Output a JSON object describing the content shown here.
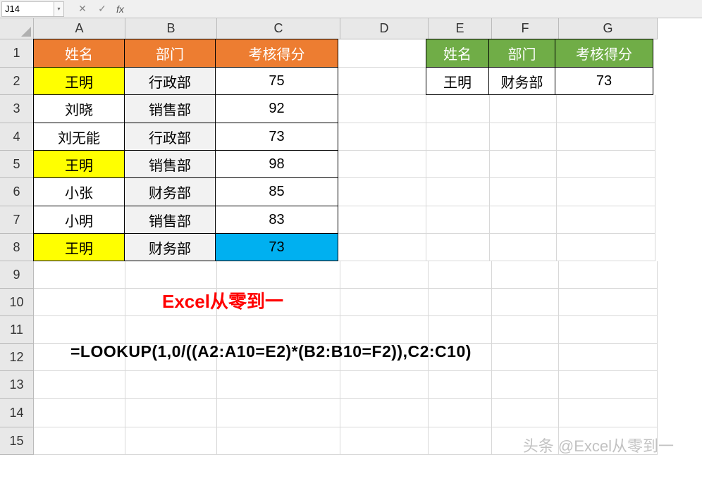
{
  "name_box": "J14",
  "fx_label": "fx",
  "columns": [
    "A",
    "B",
    "C",
    "D",
    "E",
    "F",
    "G"
  ],
  "rows": [
    "1",
    "2",
    "3",
    "4",
    "5",
    "6",
    "7",
    "8",
    "9",
    "10",
    "11",
    "12",
    "13",
    "14",
    "15"
  ],
  "table1": {
    "headers": [
      "姓名",
      "部门",
      "考核得分"
    ],
    "rows": [
      {
        "name": "王明",
        "dept": "行政部",
        "score": "75",
        "hl": true
      },
      {
        "name": "刘晓",
        "dept": "销售部",
        "score": "92",
        "hl": false
      },
      {
        "name": "刘无能",
        "dept": "行政部",
        "score": "73",
        "hl": false
      },
      {
        "name": "王明",
        "dept": "销售部",
        "score": "98",
        "hl": true
      },
      {
        "name": "小张",
        "dept": "财务部",
        "score": "85",
        "hl": false
      },
      {
        "name": "小明",
        "dept": "销售部",
        "score": "83",
        "hl": false
      },
      {
        "name": "王明",
        "dept": "财务部",
        "score": "73",
        "hl": true,
        "result": true
      }
    ]
  },
  "table2": {
    "headers": [
      "姓名",
      "部门",
      "考核得分"
    ],
    "row": {
      "name": "王明",
      "dept": "财务部",
      "score": "73"
    }
  },
  "title_text": "Excel从零到一",
  "formula_text": "=LOOKUP(1,0/((A2:A10=E2)*(B2:B10=F2)),C2:C10)",
  "watermark_text": "头条 @Excel从零到一",
  "icons": {
    "dd": "▾",
    "cancel": "✕",
    "accept": "✓"
  }
}
